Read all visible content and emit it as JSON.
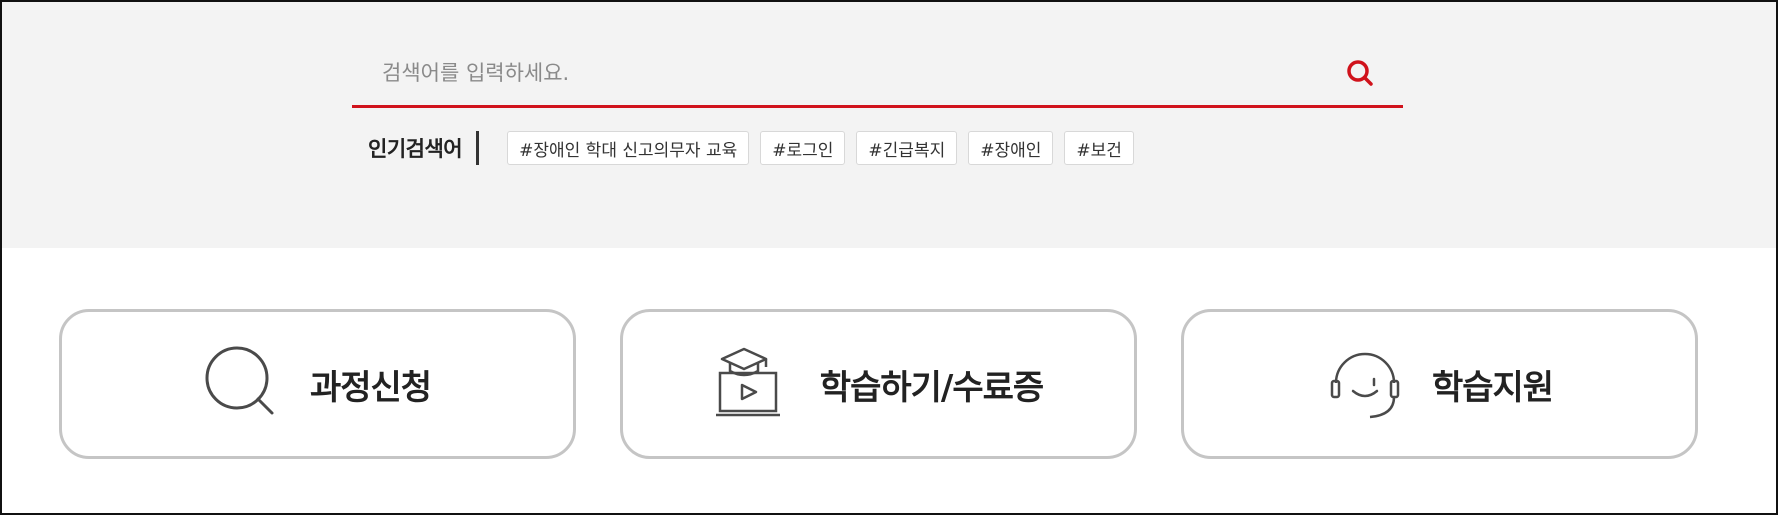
{
  "search": {
    "placeholder": "검색어를 입력하세요.",
    "button_icon": "search-icon",
    "accent_color": "#d0121b"
  },
  "popular": {
    "label": "인기검색어",
    "tags": [
      "#장애인 학대 신고의무자 교육",
      "#로그인",
      "#긴급복지",
      "#장애인",
      "#보건"
    ]
  },
  "quick_links": [
    {
      "label": "과정신청",
      "icon": "magnifier-icon"
    },
    {
      "label": "학습하기/수료증",
      "icon": "graduation-video-icon"
    },
    {
      "label": "학습지원",
      "icon": "headset-smile-icon"
    }
  ]
}
